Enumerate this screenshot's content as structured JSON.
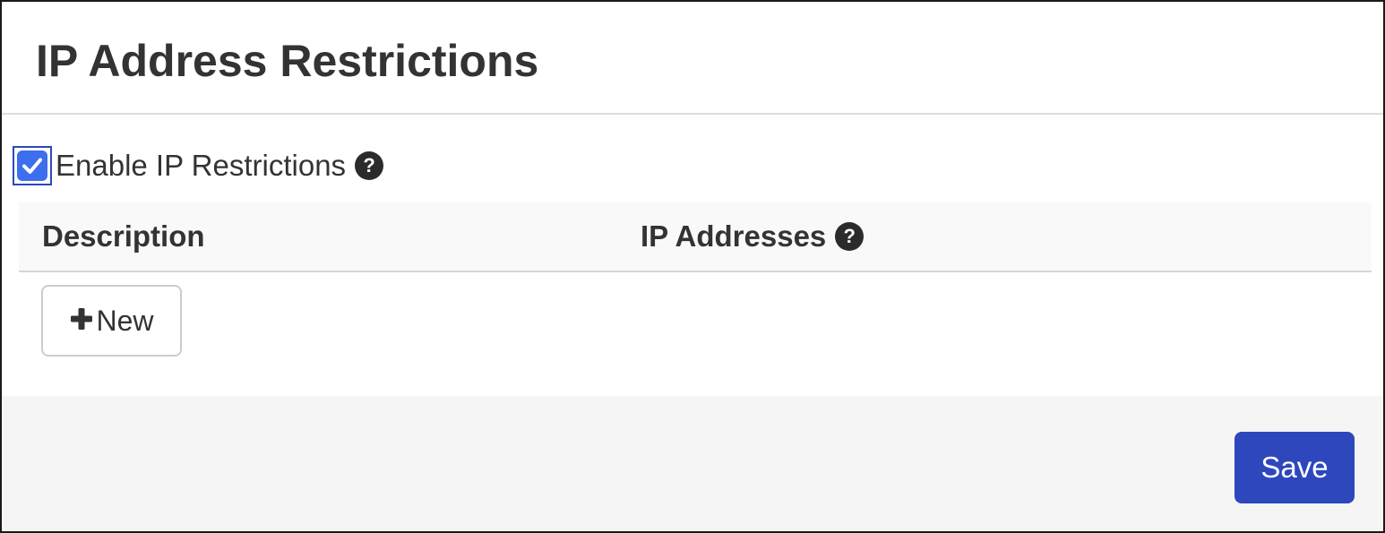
{
  "panel": {
    "title": "IP Address Restrictions"
  },
  "restrictions": {
    "enable_label": "Enable IP Restrictions",
    "enabled": true,
    "help_icon": "question-circle-icon"
  },
  "table": {
    "columns": [
      {
        "label": "Description",
        "help": false
      },
      {
        "label": "IP Addresses",
        "help": true
      }
    ],
    "rows": []
  },
  "actions": {
    "new_label": "New",
    "new_icon": "plus-icon",
    "save_label": "Save"
  },
  "colors": {
    "primary": "#2e47bd",
    "checkbox": "#3d6ef0",
    "footer_bg": "#f5f5f5"
  }
}
